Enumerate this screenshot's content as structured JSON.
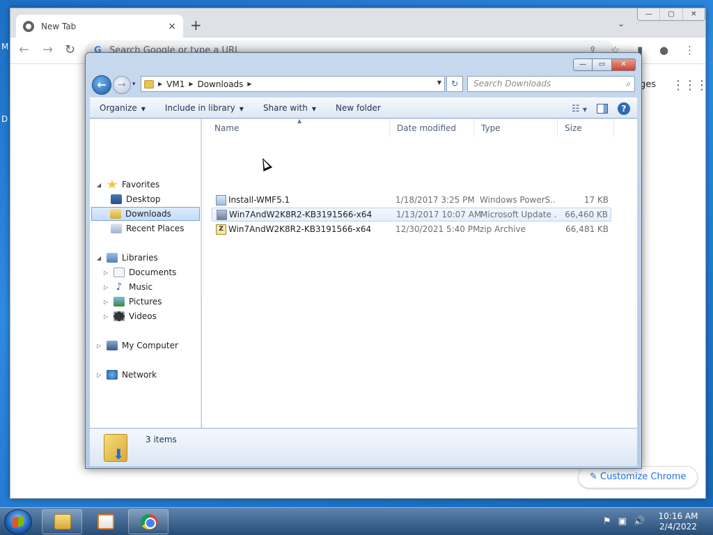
{
  "desktop": {
    "edge_fragment_1": "M",
    "edge_fragment_2": "D"
  },
  "chrome": {
    "tab_title": "New Tab",
    "tab_close": "×",
    "new_tab": "+",
    "tab_list": "⌄",
    "omnibox_placeholder": "Search Google or type a URL",
    "omnibox_g": "G",
    "images_link": "ges",
    "apps_icon": "⋮⋮⋮",
    "customize_label": "✎  Customize Chrome",
    "win_min": "—",
    "win_max": "▢",
    "win_close": "✕"
  },
  "explorer": {
    "caption": {
      "min": "—",
      "max": "▭",
      "close": "✕"
    },
    "back": "←",
    "forward": "→",
    "recent_pages": "▾",
    "address": {
      "root": "VM1",
      "folder": "Downloads"
    },
    "refresh": "↻",
    "search_placeholder": "Search Downloads",
    "search_icon": "⌕",
    "commands": {
      "organize": "Organize",
      "include_in_library": "Include in library",
      "share_with": "Share with",
      "new_folder": "New folder",
      "dropdown": "▼",
      "help": "?"
    },
    "nav": {
      "favorites": "Favorites",
      "desktop": "Desktop",
      "downloads": "Downloads",
      "recent_places": "Recent Places",
      "libraries": "Libraries",
      "documents": "Documents",
      "music": "Music",
      "pictures": "Pictures",
      "videos": "Videos",
      "my_computer": "My Computer",
      "network": "Network"
    },
    "columns": {
      "name": "Name",
      "date": "Date modified",
      "type": "Type",
      "size": "Size"
    },
    "files": [
      {
        "name": "Install-WMF5.1",
        "date": "1/18/2017 3:25 PM",
        "type": "Windows PowerS...",
        "size": "17 KB"
      },
      {
        "name": "Win7AndW2K8R2-KB3191566-x64",
        "date": "1/13/2017 10:07 AM",
        "type": "Microsoft Update ...",
        "size": "66,460 KB"
      },
      {
        "name": "Win7AndW2K8R2-KB3191566-x64",
        "date": "12/30/2021 5:40 PM",
        "type": "zip Archive",
        "size": "66,481 KB"
      }
    ],
    "status_count": "3 items"
  },
  "taskbar": {
    "tray_icons": [
      "⚑",
      "▣",
      "🔊"
    ],
    "time": "10:16 AM",
    "date": "2/4/2022"
  }
}
